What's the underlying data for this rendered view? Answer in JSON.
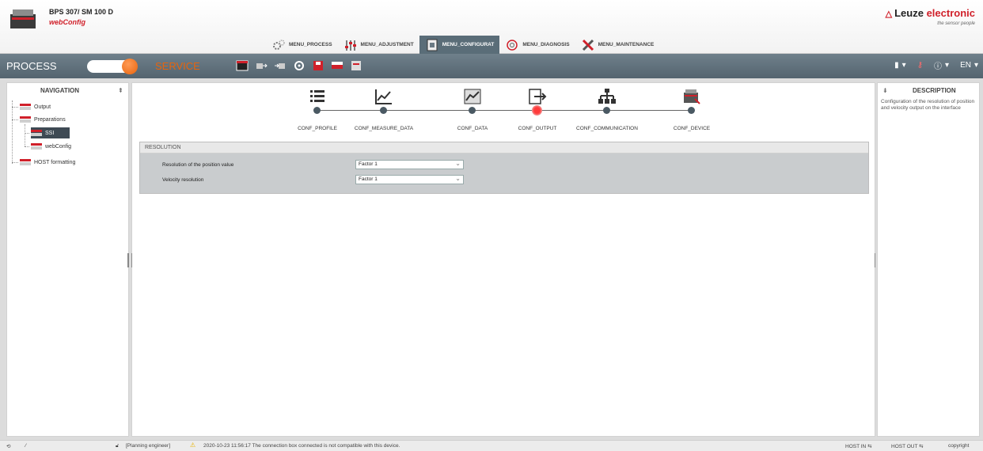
{
  "device": {
    "name": "BPS 307/ SM 100 D",
    "app": "webConfig"
  },
  "brand": {
    "name_black": "Leuze",
    "name_red": "electronic",
    "tagline": "the sensor people"
  },
  "menu_tabs": [
    {
      "label": "MENU_PROCESS",
      "icon": "gears-icon"
    },
    {
      "label": "MENU_ADJUSTMENT",
      "icon": "sliders-icon"
    },
    {
      "label": "MENU_CONFIGURAT",
      "icon": "clipboard-icon"
    },
    {
      "label": "MENU_DIAGNOSIS",
      "icon": "stethoscope-icon"
    },
    {
      "label": "MENU_MAINTENANCE",
      "icon": "wrench-icon"
    }
  ],
  "toolbar": {
    "process": "PROCESS",
    "service": "SERVICE",
    "language": "EN"
  },
  "navigation": {
    "title": "NAVIGATION",
    "items": [
      "Output",
      "Preparations",
      "SSI",
      "webConfig",
      "HOST formatting"
    ]
  },
  "steps": [
    {
      "label": "CONF_PROFILE",
      "icon": "list-icon"
    },
    {
      "label": "CONF_MEASURE_DATA",
      "icon": "line-chart-icon"
    },
    {
      "label": "CONF_DATA",
      "icon": "chart-image-icon"
    },
    {
      "label": "CONF_OUTPUT",
      "icon": "output-arrow-icon"
    },
    {
      "label": "CONF_COMMUNICATION",
      "icon": "network-icon"
    },
    {
      "label": "CONF_DEVICE",
      "icon": "device-icon"
    }
  ],
  "resolution": {
    "title": "RESOLUTION",
    "rows": [
      {
        "label": "Resolution of the position value",
        "value": "Factor 1"
      },
      {
        "label": "Velocity resolution",
        "value": "Factor 1"
      }
    ]
  },
  "description": {
    "title": "DESCRIPTION",
    "text": "Configuration of the resolution of position and velocity output on the interface"
  },
  "status": {
    "role": "[Planning engineer]",
    "message": "2020-10-23 11:56:17 The connection box connected is not compatible with this device.",
    "host_in": "HOST IN",
    "host_out": "HOST OUT",
    "copyright": "copyright"
  },
  "colors": {
    "accent_red": "#d0202a",
    "service_orange": "#e8640c",
    "toolbar": "#5f707b"
  }
}
